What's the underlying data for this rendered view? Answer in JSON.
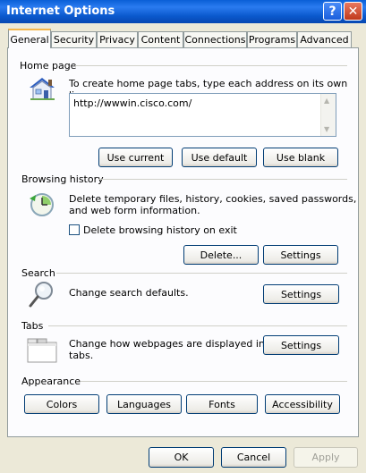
{
  "window": {
    "title": "Internet Options"
  },
  "titlebar": {
    "help_glyph": "?",
    "close_glyph": "✕"
  },
  "tabs": [
    {
      "label": "General",
      "active": true
    },
    {
      "label": "Security"
    },
    {
      "label": "Privacy"
    },
    {
      "label": "Content"
    },
    {
      "label": "Connections"
    },
    {
      "label": "Programs"
    },
    {
      "label": "Advanced"
    }
  ],
  "home_page": {
    "label": "Home page",
    "description": "To create home page tabs, type each address on its own line.",
    "address": "http://wwwin.cisco.com/",
    "buttons": {
      "use_current": "Use current",
      "use_default": "Use default",
      "use_blank": "Use blank"
    },
    "icon": "house-icon"
  },
  "browsing_history": {
    "label": "Browsing history",
    "description_line1": "Delete temporary files, history, cookies, saved passwords,",
    "description_line2": "and web form information.",
    "checkbox_label": "Delete browsing history on exit",
    "checkbox_checked": false,
    "buttons": {
      "delete": "Delete...",
      "settings": "Settings"
    },
    "icon": "history-clock-icon"
  },
  "search": {
    "label": "Search",
    "description": "Change search defaults.",
    "buttons": {
      "settings": "Settings"
    },
    "icon": "magnifier-icon"
  },
  "tabs_section": {
    "label": "Tabs",
    "description_line1": "Change how webpages are displayed in",
    "description_line2": "tabs.",
    "buttons": {
      "settings": "Settings"
    },
    "icon": "tabbed-window-icon"
  },
  "appearance": {
    "label": "Appearance",
    "buttons": {
      "colors": "Colors",
      "languages": "Languages",
      "fonts": "Fonts",
      "accessibility": "Accessibility"
    }
  },
  "footer": {
    "ok": "OK",
    "cancel": "Cancel",
    "apply": "Apply",
    "apply_enabled": false
  },
  "colors": {
    "title_bar": "#0a58cc",
    "dialog_bg": "#ece9d8",
    "panel_bg": "#fcfcfe",
    "tab_highlight": "#f5b64a",
    "button_border": "#003c74"
  }
}
